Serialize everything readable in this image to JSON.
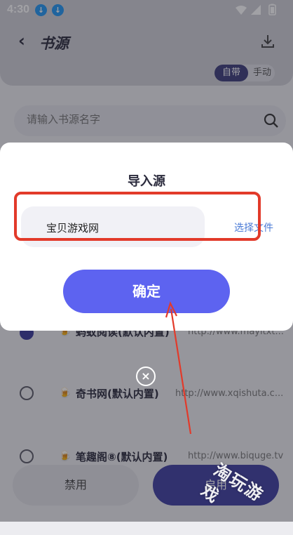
{
  "status_bar": {
    "time": "4:30"
  },
  "header": {
    "title": "书源"
  },
  "source_toggle": {
    "builtin": "自带",
    "manual": "手动"
  },
  "search": {
    "placeholder": "请输入书源名字"
  },
  "sources": [
    {
      "name": "蚂蚁阅读(默认内置)",
      "url": "http://www.mayitxt...",
      "selected": true
    },
    {
      "name": "奇书网(默认内置)",
      "url": "http://www.xqishuta.c...",
      "selected": false
    },
    {
      "name": "笔趣阁⑧(默认内置)",
      "url": "http://www.biquge.tv",
      "selected": false
    }
  ],
  "bottom_bar": {
    "disable": "禁用",
    "enable": "启用"
  },
  "dialog": {
    "title": "导入源",
    "import_value": "宝贝游戏网",
    "choose_file": "选择文件",
    "confirm": "确定"
  },
  "watermark": "淘玩游戏",
  "colors": {
    "accent": "#5d63f0",
    "highlight": "#e23a2a",
    "link": "#4b7bd6"
  }
}
